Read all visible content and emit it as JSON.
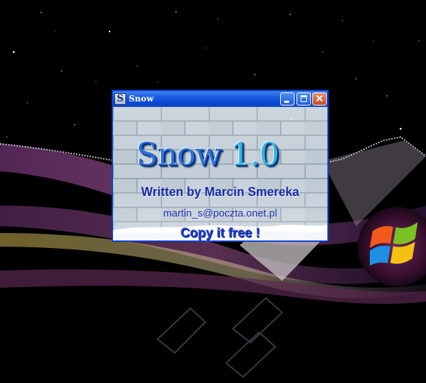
{
  "window": {
    "title": "Snow",
    "app_icon": "S",
    "controls": {
      "minimize": "minimize-icon",
      "maximize": "maximize-icon",
      "close": "close-icon",
      "close_glyph": "✕"
    }
  },
  "content": {
    "logo_name": "Snow",
    "logo_version": "1.0",
    "author": "Written by Marcin Smereka",
    "email": "martin_s@poczta.onet.pl",
    "slogan": "Copy it free !"
  },
  "desktop": {
    "logo": "windows-logo-icon"
  },
  "colors": {
    "titlebar": "#0b4bd6",
    "text_blue": "#1a2aa6",
    "brick": "#b9c5cf"
  }
}
